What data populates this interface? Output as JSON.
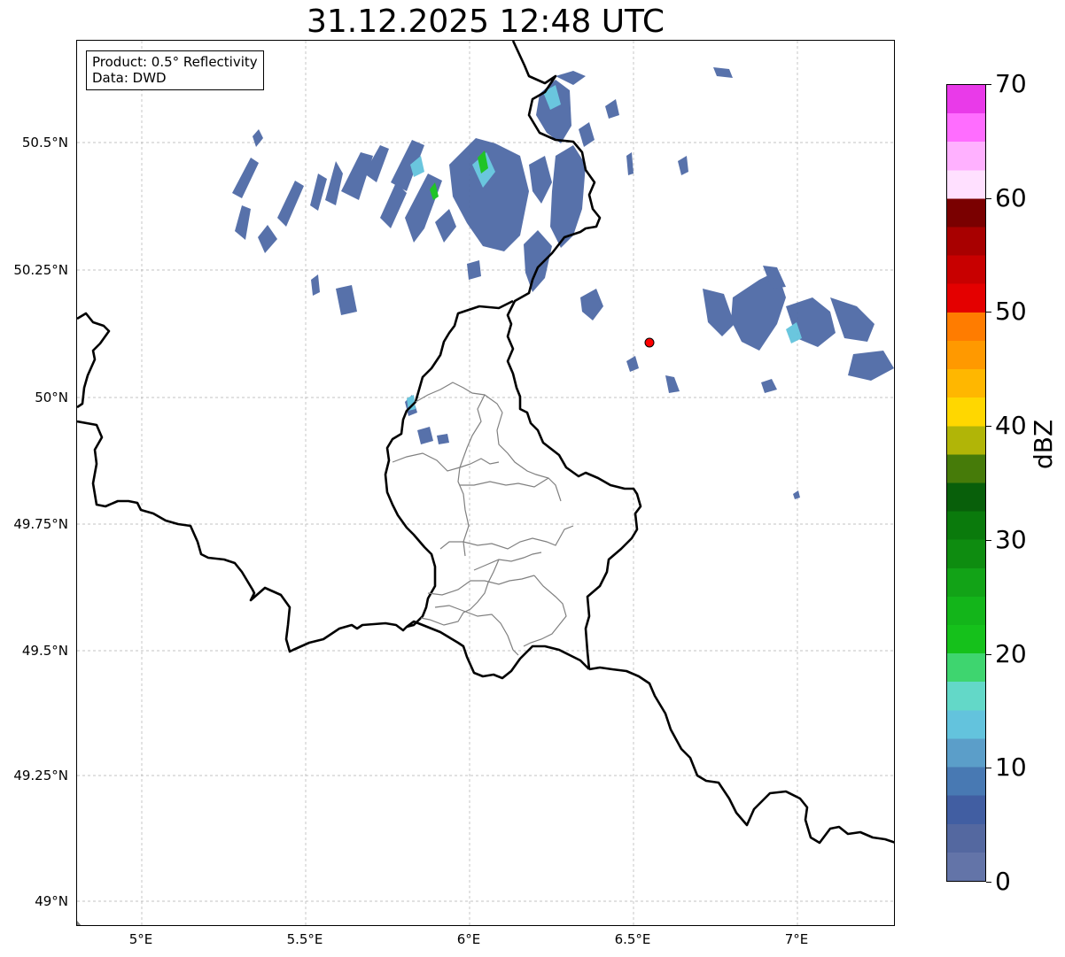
{
  "title": "31.12.2025 12:48 UTC",
  "info_box": {
    "product": "Product: 0.5° Reflectivity",
    "source": "Data: DWD"
  },
  "map": {
    "lat_labels": [
      "50.5°N",
      "50.25°N",
      "50°N",
      "49.75°N",
      "49.5°N",
      "49.25°N",
      "49°N"
    ],
    "lon_labels": [
      "5°E",
      "5.5°E",
      "6°E",
      "6.5°E",
      "7°E"
    ],
    "border_color": "#000000",
    "admin_border_color": "#808080",
    "radar_site_color": "#ff0000"
  },
  "colorbar": {
    "unit": "dBZ",
    "tick_labels": [
      "0",
      "10",
      "20",
      "30",
      "40",
      "50",
      "60",
      "70"
    ],
    "min": 0,
    "max": 70,
    "colors": [
      "#6374a8",
      "#5468a0",
      "#415ea2",
      "#4879b3",
      "#5b9ec9",
      "#63c3dd",
      "#63d8c8",
      "#3ed56f",
      "#15c11b",
      "#13b51a",
      "#12a317",
      "#0e8c10",
      "#0a7a0c",
      "#085f0a",
      "#467b09",
      "#b1b507",
      "#ffd700",
      "#ffb700",
      "#ff9900",
      "#ff7c00",
      "#e40000",
      "#c80000",
      "#a80000",
      "#7a0000",
      "#ffe0ff",
      "#ffb1ff",
      "#ff6dff",
      "#e93ae9"
    ]
  }
}
